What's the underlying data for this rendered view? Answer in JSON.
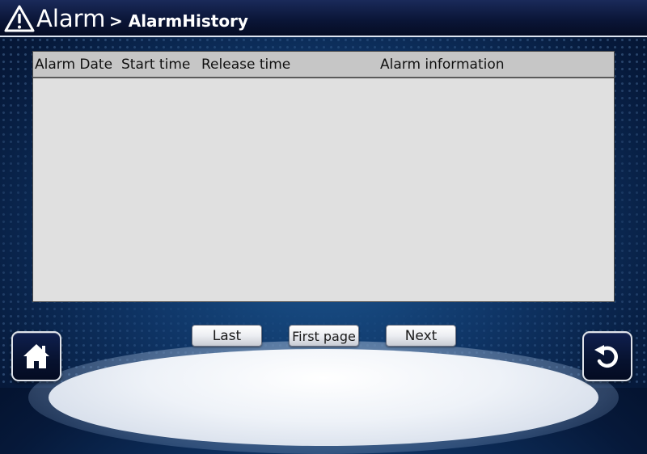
{
  "header": {
    "title": "Alarm",
    "breadcrumb_sub": "> AlarmHistory"
  },
  "table": {
    "columns": [
      "Alarm Date",
      "Start time",
      "Release time",
      "Alarm information"
    ],
    "rows": []
  },
  "pagination": {
    "last_label": "Last",
    "first_page_label": "First page",
    "next_label": "Next"
  },
  "nav": {
    "home_icon": "home-icon",
    "back_icon": "back-arrow-icon"
  }
}
